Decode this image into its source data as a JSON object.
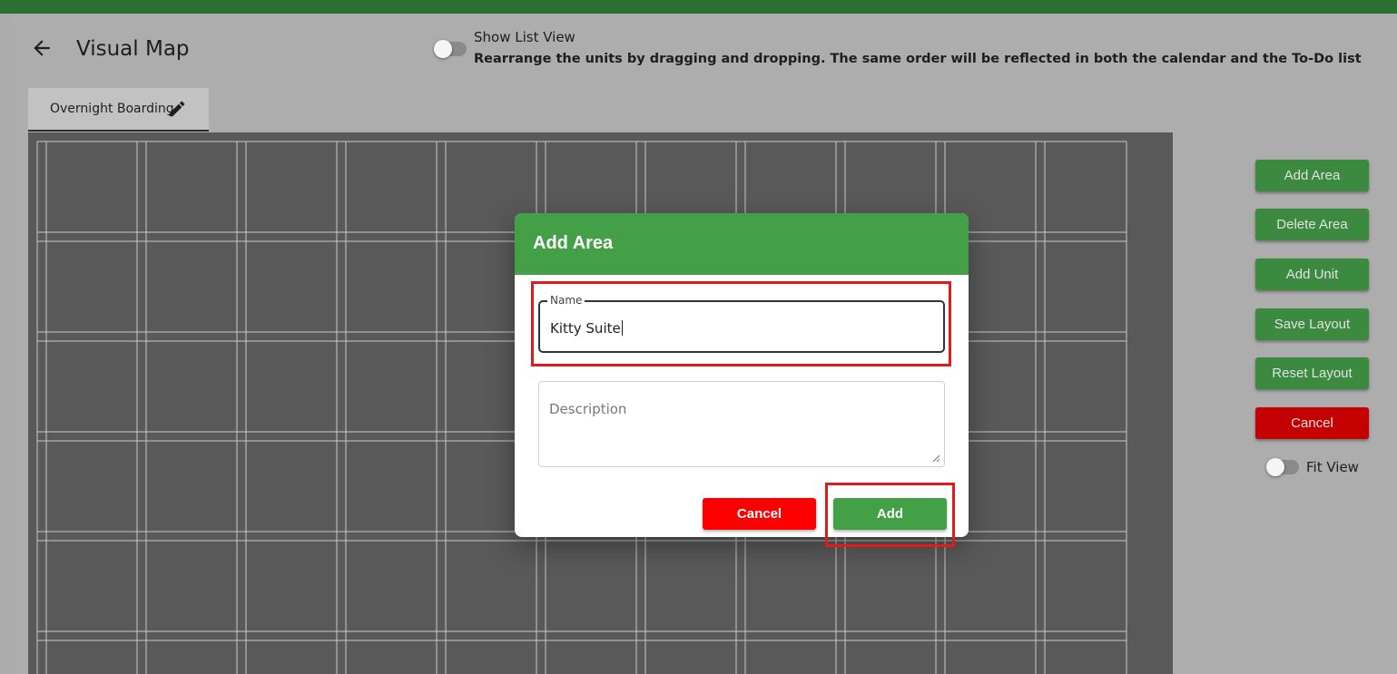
{
  "header": {
    "title": "Visual Map",
    "show_list_view_label": "Show List View",
    "rearrange_hint": "Rearrange the units by dragging and dropping. The same order will be reflected in both the calendar and the To-Do list"
  },
  "tabs": [
    {
      "label": "Overnight Boarding",
      "icon": "pencil-icon"
    }
  ],
  "side_panel": {
    "buttons": [
      "Add Area",
      "Delete Area",
      "Add Unit",
      "Save Layout",
      "Reset Layout",
      "Cancel"
    ],
    "fit_view_label": "Fit View"
  },
  "modal": {
    "title": "Add Area",
    "name_label": "Name",
    "name_value": "Kitty Suite",
    "description_placeholder": "Description",
    "cancel_label": "Cancel",
    "add_label": "Add"
  },
  "colors": {
    "header_green": "#43a047",
    "button_green": "#3b8a3f",
    "cancel_red": "#ff0000",
    "highlight_red": "#e01b1b",
    "canvas_gray": "#595959"
  }
}
